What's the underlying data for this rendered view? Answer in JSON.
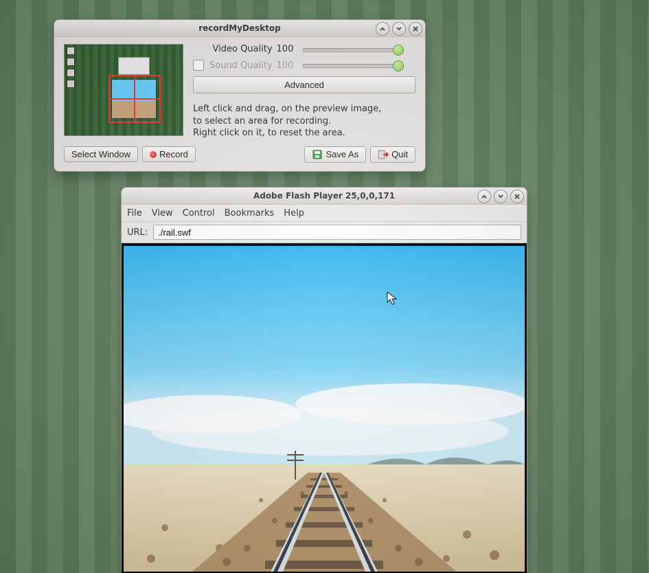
{
  "rmd": {
    "title": "recordMyDesktop",
    "video_quality": {
      "label": "Video Quality",
      "value": "100"
    },
    "sound_quality": {
      "label": "Sound Quality",
      "value": "100",
      "enabled": false
    },
    "advanced": "Advanced",
    "instructions_line1": "Left click and drag, on the preview image,",
    "instructions_line2": "to select an area for recording.",
    "instructions_line3": "Right click on it, to reset the area.",
    "select_window": "Select Window",
    "record": "Record",
    "save_as": "Save As",
    "quit": "Quit"
  },
  "flash": {
    "title": "Adobe Flash Player 25,0,0,171",
    "menu": {
      "file": "File",
      "view": "View",
      "control": "Control",
      "bookmarks": "Bookmarks",
      "help": "Help"
    },
    "url_label": "URL:",
    "url_value": "./rail.swf"
  }
}
